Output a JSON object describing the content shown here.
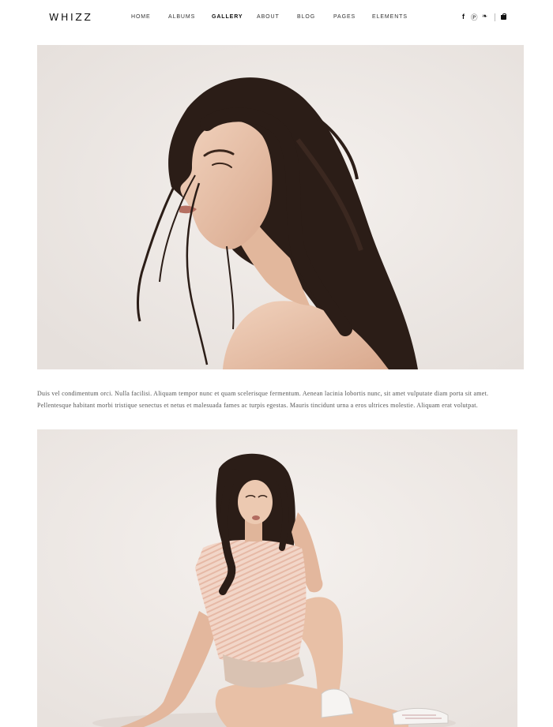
{
  "header": {
    "logo": "WHIZZ",
    "nav": [
      {
        "label": "HOME",
        "active": false
      },
      {
        "label": "ALBUMS",
        "active": false
      },
      {
        "label": "GALLERY",
        "active": true
      },
      {
        "label": "ABOUT",
        "active": false
      },
      {
        "label": "BLOG",
        "active": false
      },
      {
        "label": "PAGES",
        "active": false
      },
      {
        "label": "ELEMENTS",
        "active": false
      }
    ],
    "social": [
      {
        "icon": "facebook-icon",
        "glyph": "f"
      },
      {
        "icon": "pinterest-icon",
        "glyph": "Ⓟ"
      },
      {
        "icon": "twitter-icon",
        "glyph": "❧"
      }
    ],
    "cart_icon": "shopping-bag-icon"
  },
  "gallery": {
    "items": [
      {
        "image": "portrait-woman-profile-dark-hair"
      },
      {
        "image": "woman-sitting-striped-top"
      }
    ],
    "caption": "Duis vel condimentum orci. Nulla facilisi. Aliquam tempor nunc et quam scelerisque fermentum. Aenean lacinia lobortis nunc, sit amet vulputate diam porta sit amet. Pellentesque habitant morbi tristique senectus et netus et malesuada fames ac turpis egestas. Mauris tincidunt urna a eros ultrices molestie. Aliquam erat volutpat."
  },
  "colors": {
    "background": "#ffffff",
    "photo_backdrop": "#efeae6",
    "hair": "#2a1c16",
    "skin": "#e8c3a8",
    "top": "#f0cfc0"
  }
}
